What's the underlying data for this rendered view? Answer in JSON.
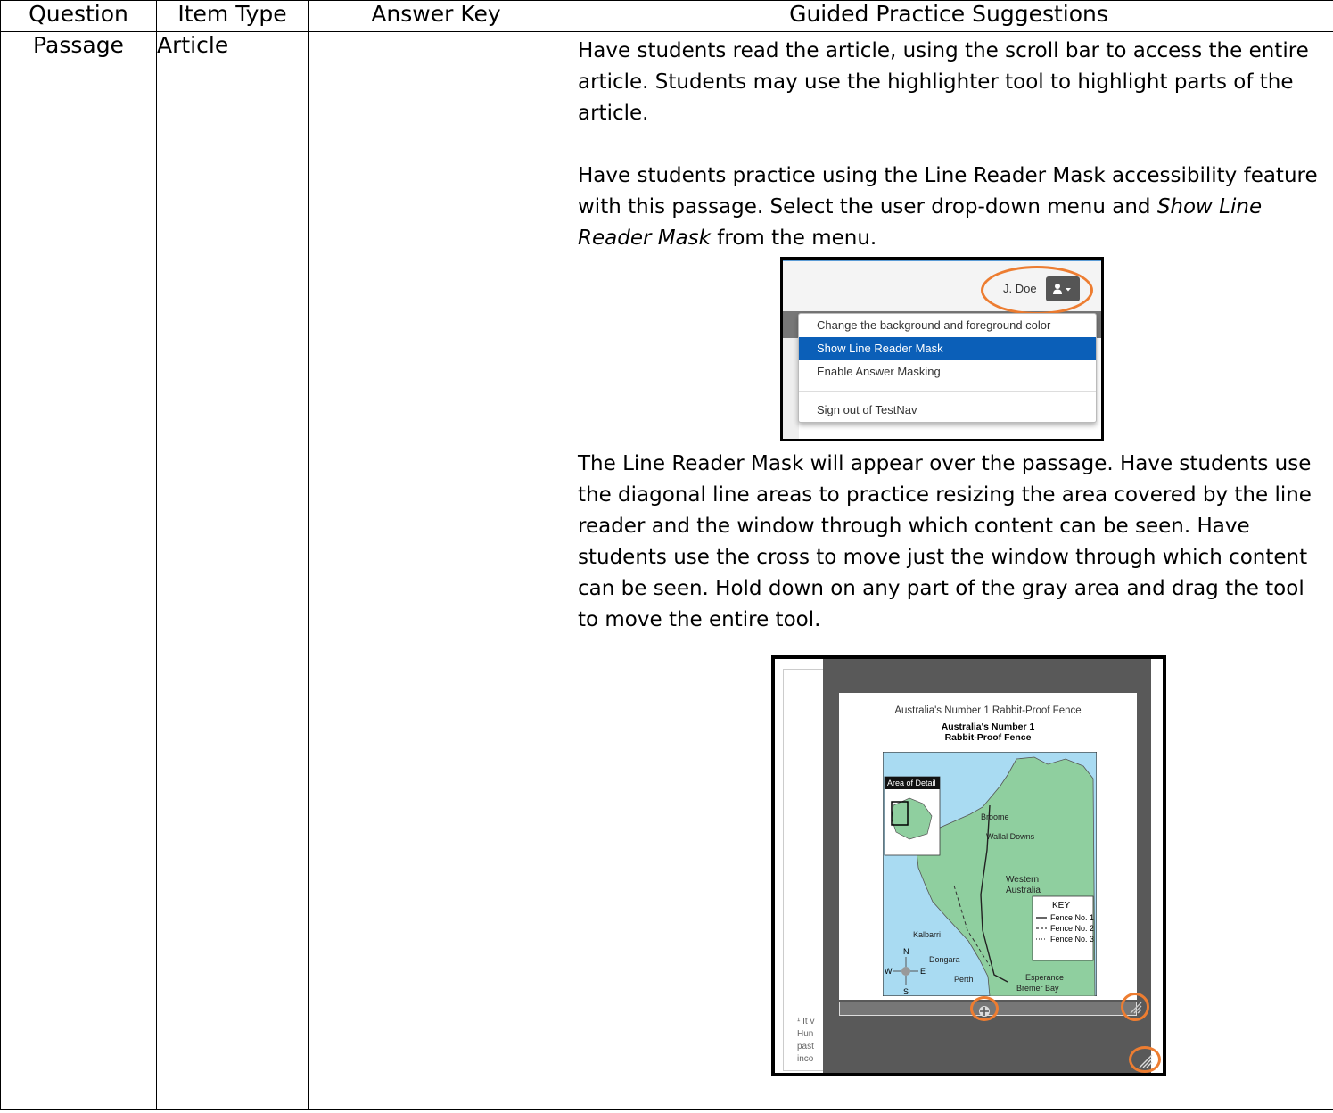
{
  "table": {
    "headers": [
      "Question",
      "Item Type",
      "Answer Key",
      "Guided Practice Suggestions"
    ],
    "row": {
      "question": "Passage",
      "item_type": "Article",
      "answer_key": ""
    }
  },
  "guidance": {
    "p1": "Have students read the article, using the scroll bar to access the entire article. Students may use the highlighter tool to highlight parts of the article.",
    "p2_start": "Have students practice using the Line Reader Mask accessibility feature with this passage.  Select the user drop-down menu and ",
    "p2_italic": "Show Line Reader Mask",
    "p2_end": " from the menu.",
    "p3": "The Line Reader Mask will appear over the passage. Have students use the diagonal line areas to practice resizing the area covered by the line reader and the window through which content can be seen.  Have students use the cross to move just the window through which content can be seen.  Hold down on any part of the gray area and drag the tool to move the entire tool."
  },
  "screenshot_menu": {
    "user_name": "J. Doe",
    "items": [
      "Change the background and foreground color",
      "Show Line Reader Mask",
      "Enable Answer Masking",
      "Sign out of TestNav"
    ],
    "selected_item": "Show Line Reader Mask",
    "accent_color": "#ed7d31",
    "highlight_color": "#0b5fb8"
  },
  "screenshot_mask": {
    "window_title": "Australia's Number 1 Rabbit-Proof Fence",
    "map_title_line1": "Australia's Number 1",
    "map_title_line2": "Rabbit-Proof Fence",
    "inset_label": "Area of Detail",
    "places": [
      "Broome",
      "Wallal Downs",
      "Western",
      "Australia",
      "Kalbarri",
      "Dongara",
      "Perth",
      "Esperance",
      "Bremer Bay"
    ],
    "key_title": "KEY",
    "key_items": [
      "Fence No. 1",
      "Fence No. 2",
      "Fence No. 3"
    ],
    "compass": [
      "N",
      "W",
      "E",
      "S"
    ],
    "footnote_fragments": [
      "¹ It v",
      "Hun",
      "past",
      "inco"
    ],
    "mask_color": "#595959"
  }
}
